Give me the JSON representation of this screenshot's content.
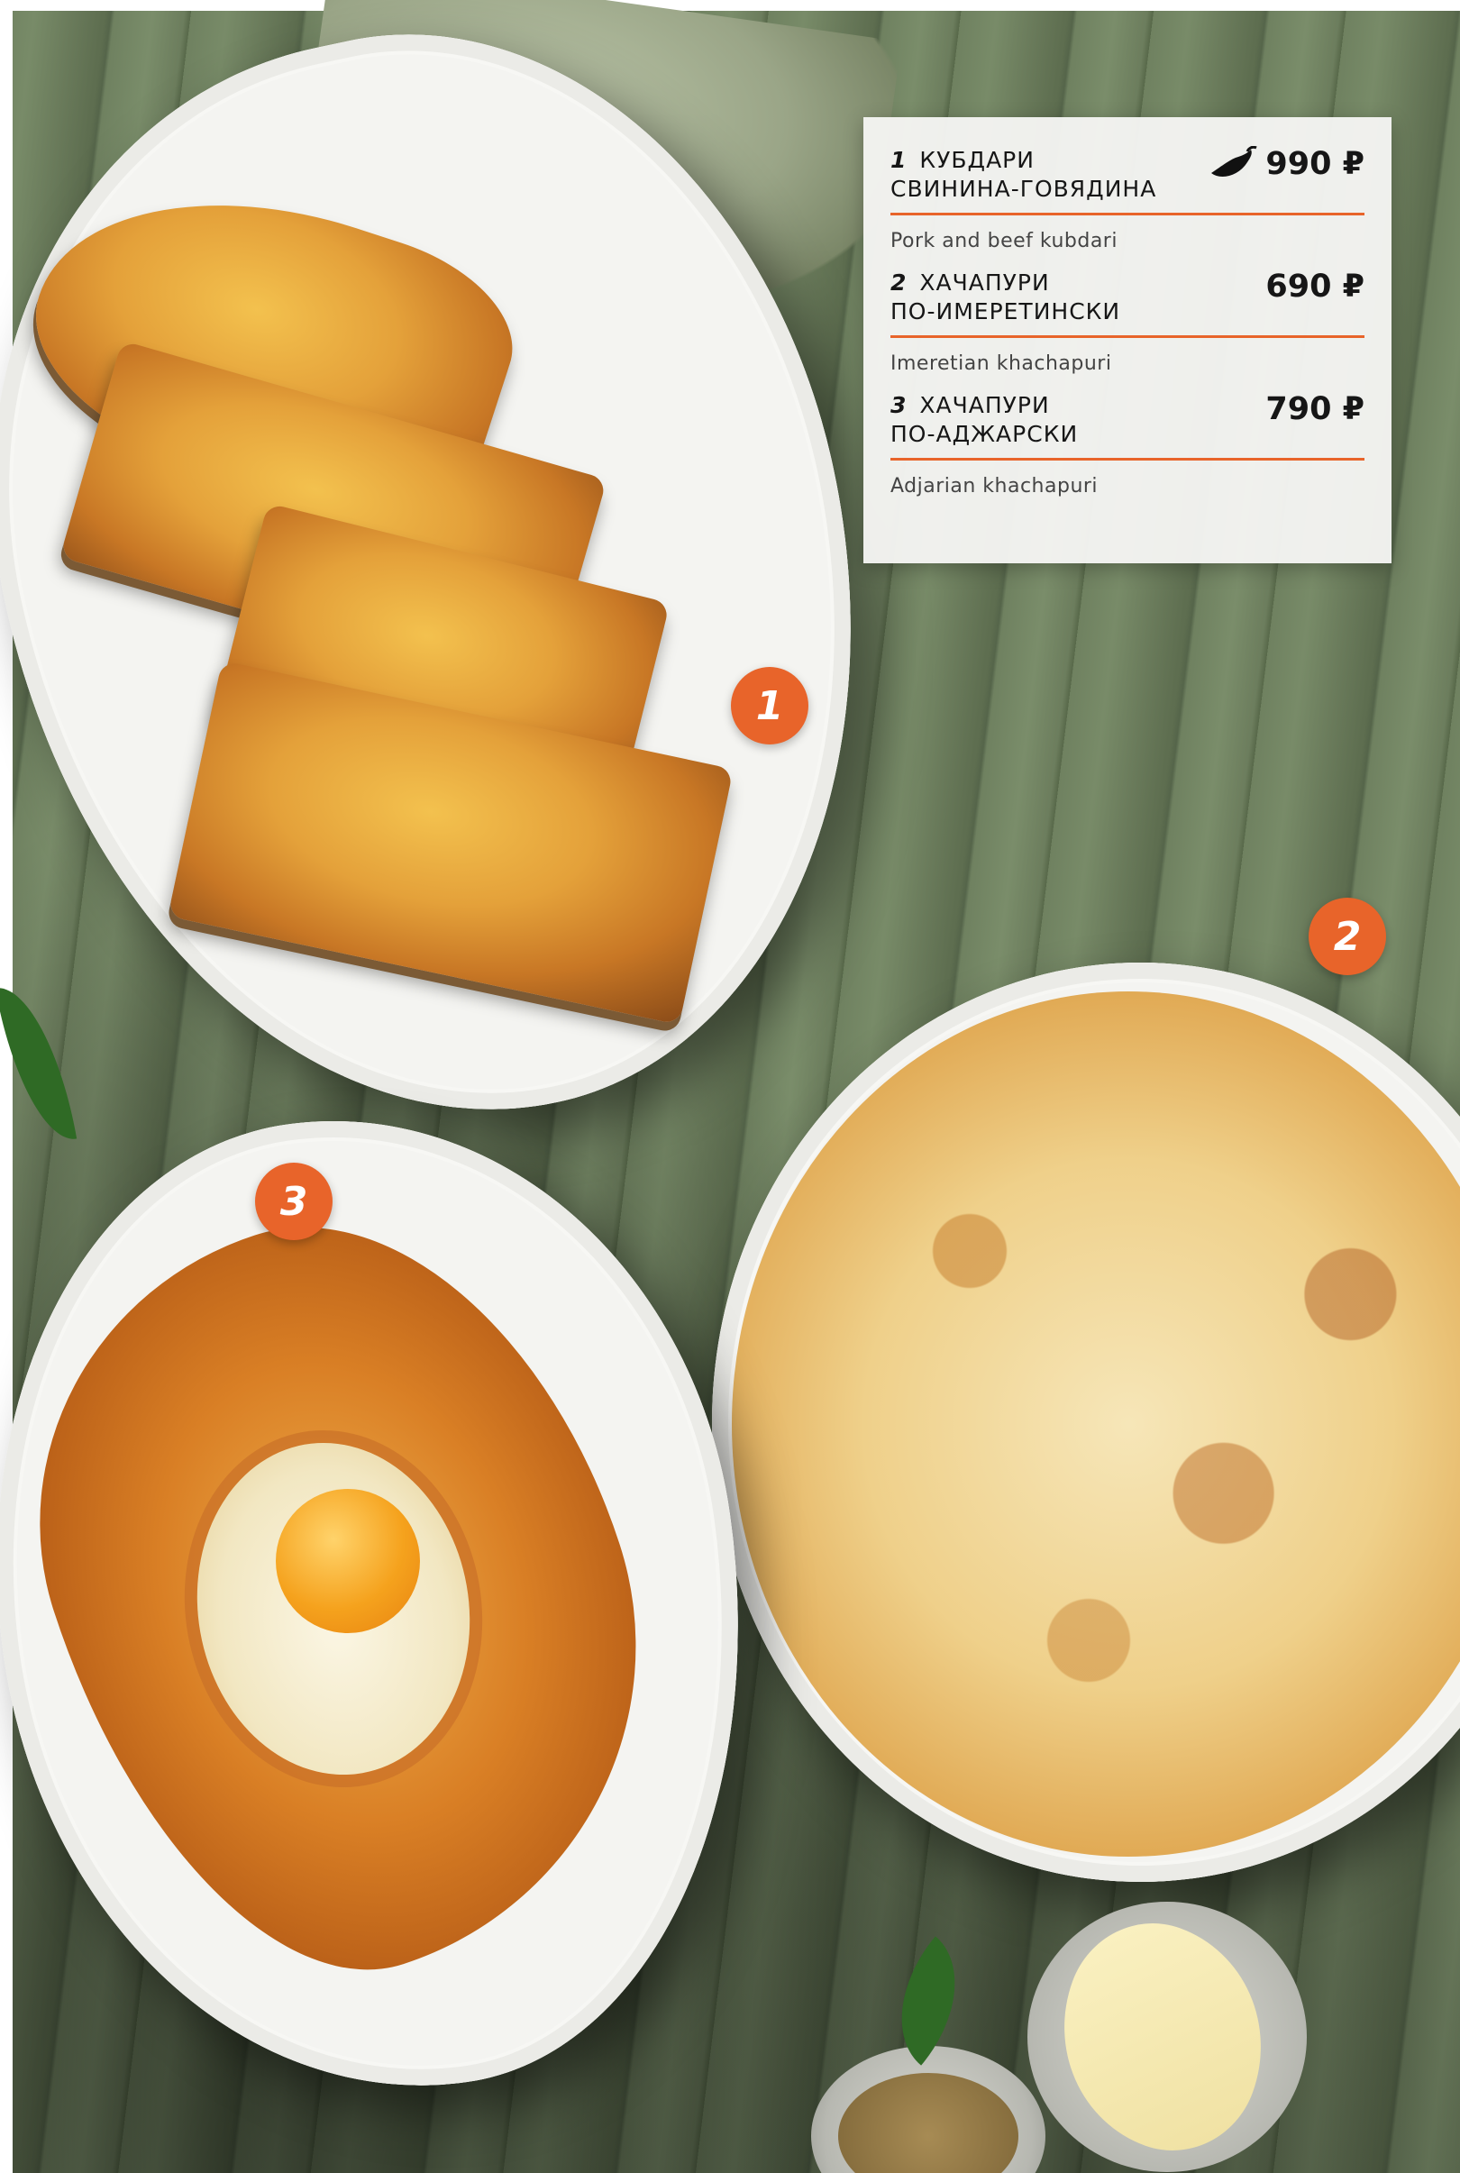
{
  "menu": {
    "items": [
      {
        "number": "1",
        "title_line1": "КУБДАРИ",
        "title_line2": "СВИНИНА-ГОВЯДИНА",
        "price": "990 ₽",
        "spicy": true,
        "subtitle": "Pork and beef kubdari"
      },
      {
        "number": "2",
        "title_line1": "ХАЧАПУРИ",
        "title_line2": "ПО-ИМЕРЕТИНСКИ",
        "price": "690 ₽",
        "spicy": false,
        "subtitle": "Imeretian khachapuri"
      },
      {
        "number": "3",
        "title_line1": "ХАЧАПУРИ",
        "title_line2": "ПО-АДЖАРСКИ",
        "price": "790 ₽",
        "spicy": false,
        "subtitle": "Adjarian khachapuri"
      }
    ]
  },
  "badges": [
    "1",
    "2",
    "3"
  ],
  "colors": {
    "accent": "#e8642a",
    "card": "#f5f5f3",
    "text": "#161616"
  },
  "icons": {
    "spicy": "chili-pepper-icon"
  }
}
